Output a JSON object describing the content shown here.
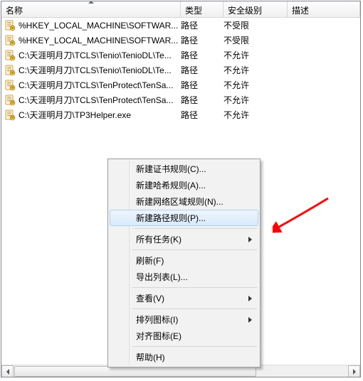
{
  "columns": {
    "name": "名称",
    "type": "类型",
    "security": "安全级别",
    "desc": "描述"
  },
  "rows": [
    {
      "name": "%HKEY_LOCAL_MACHINE\\SOFTWAR...",
      "type": "路径",
      "security": "不受限"
    },
    {
      "name": "%HKEY_LOCAL_MACHINE\\SOFTWAR...",
      "type": "路径",
      "security": "不受限"
    },
    {
      "name": "C:\\天涯明月刀\\TCLS\\Tenio\\TenioDL\\Te...",
      "type": "路径",
      "security": "不允许"
    },
    {
      "name": "C:\\天涯明月刀\\TCLS\\Tenio\\TenioDL\\Te...",
      "type": "路径",
      "security": "不允许"
    },
    {
      "name": "C:\\天涯明月刀\\TCLS\\TenProtect\\TenSa...",
      "type": "路径",
      "security": "不允许"
    },
    {
      "name": "C:\\天涯明月刀\\TCLS\\TenProtect\\TenSa...",
      "type": "路径",
      "security": "不允许"
    },
    {
      "name": "C:\\天涯明月刀\\TP3Helper.exe",
      "type": "路径",
      "security": "不允许"
    }
  ],
  "menu": {
    "new_cert": "新建证书规则(C)...",
    "new_hash": "新建哈希规则(A)...",
    "new_zone": "新建网络区域规则(N)...",
    "new_path": "新建路径规则(P)...",
    "all_tasks": "所有任务(K)",
    "refresh": "刷新(F)",
    "export": "导出列表(L)...",
    "view": "查看(V)",
    "arrange": "排列图标(I)",
    "align": "对齐图标(E)",
    "help": "帮助(H)"
  }
}
